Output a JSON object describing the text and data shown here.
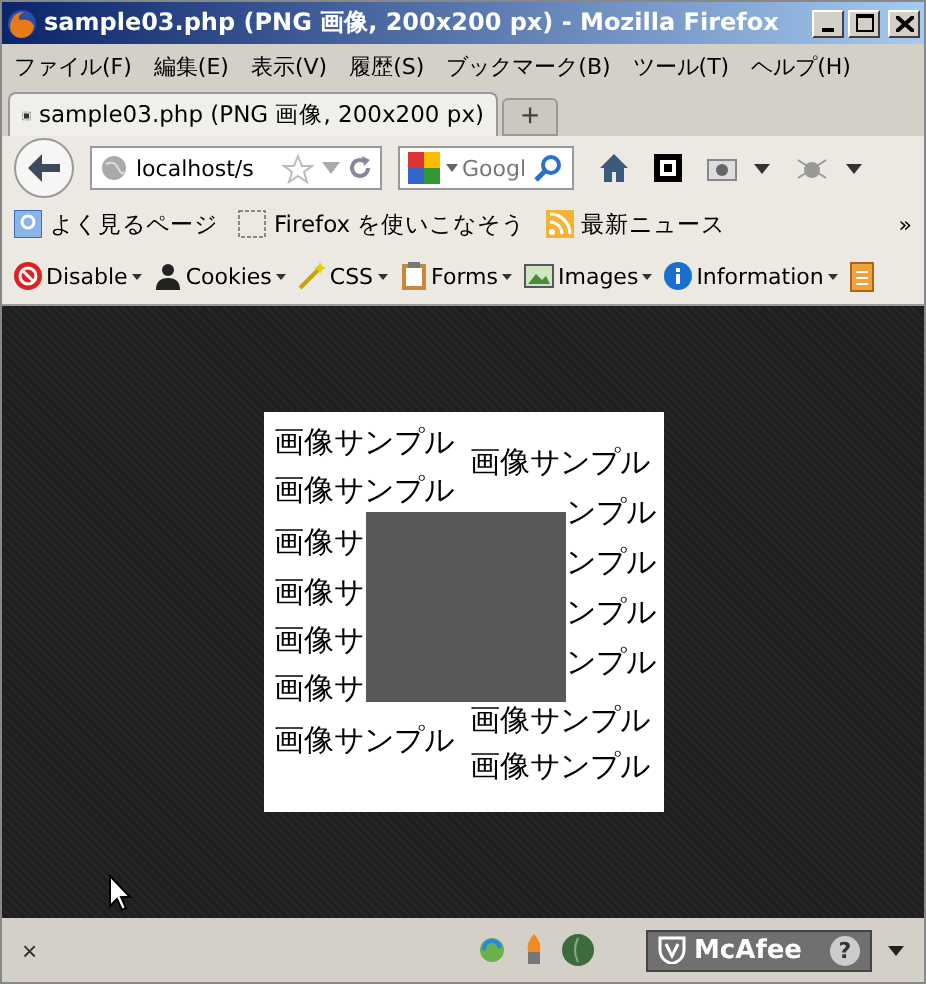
{
  "window": {
    "title": "sample03.php (PNG 画像, 200x200 px) - Mozilla Firefox"
  },
  "menu": [
    "ファイル(F)",
    "編集(E)",
    "表示(V)",
    "履歴(S)",
    "ブックマーク(B)",
    "ツール(T)",
    "ヘルプ(H)"
  ],
  "tabs": [
    {
      "label": "sample03.php (PNG 画像, 200x200 px)",
      "selected": true
    }
  ],
  "new_tab": "+",
  "address": {
    "value": "localhost/s"
  },
  "search": {
    "placeholder": "Googl"
  },
  "bookmarks": [
    {
      "label": "よく見るページ",
      "kind": "search"
    },
    {
      "label": "Firefox を使いこなそう",
      "kind": "blank"
    },
    {
      "label": "最新ニュース",
      "kind": "feed"
    }
  ],
  "bookmarks_more": "»",
  "dev_toolbar": [
    {
      "label": "Disable",
      "kind": "disable"
    },
    {
      "label": "Cookies",
      "kind": "cookies"
    },
    {
      "label": "CSS",
      "kind": "css"
    },
    {
      "label": "Forms",
      "kind": "forms"
    },
    {
      "label": "Images",
      "kind": "images"
    },
    {
      "label": "Information",
      "kind": "info"
    }
  ],
  "image": {
    "left_lines": [
      "画像サンプル",
      "画像サンプル",
      "画像サ",
      "画像サ",
      "画像サ",
      "画像サ",
      "画像サンプル"
    ],
    "right_lines": [
      "画像サンプル",
      "ンプル",
      "ンプル",
      "ンプル",
      "ンプル",
      "画像サンプル",
      "画像サンプル"
    ]
  },
  "status_bar": {
    "close": "×",
    "badge": "McAfee",
    "help": "?"
  }
}
